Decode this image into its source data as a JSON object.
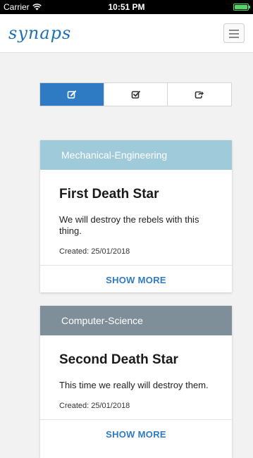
{
  "status_bar": {
    "carrier": "Carrier",
    "time": "10:51 PM",
    "battery_level": 1.0
  },
  "navbar": {
    "logo_text": "synaps",
    "menu_icon": "hamburger-icon"
  },
  "segment": {
    "tabs": [
      {
        "icon": "edit-square-icon",
        "active": true
      },
      {
        "icon": "check-square-icon",
        "active": false
      },
      {
        "icon": "share-square-icon",
        "active": false
      }
    ]
  },
  "projects": [
    {
      "category": "Mechanical-Engineering",
      "category_color": "#9fcad9",
      "title": "First Death Star",
      "description": "We will destroy the rebels with this thing.",
      "created": "Created: 25/01/2018",
      "action": "SHOW MORE"
    },
    {
      "category": "Computer-Science",
      "category_color": "#7f8f9a",
      "title": "Second Death Star",
      "description": "This time we really will destroy them.",
      "created": "Created: 25/01/2018",
      "action": "SHOW MORE"
    }
  ],
  "colors": {
    "accent": "#2f7bc3",
    "background": "#f2f2f2"
  }
}
